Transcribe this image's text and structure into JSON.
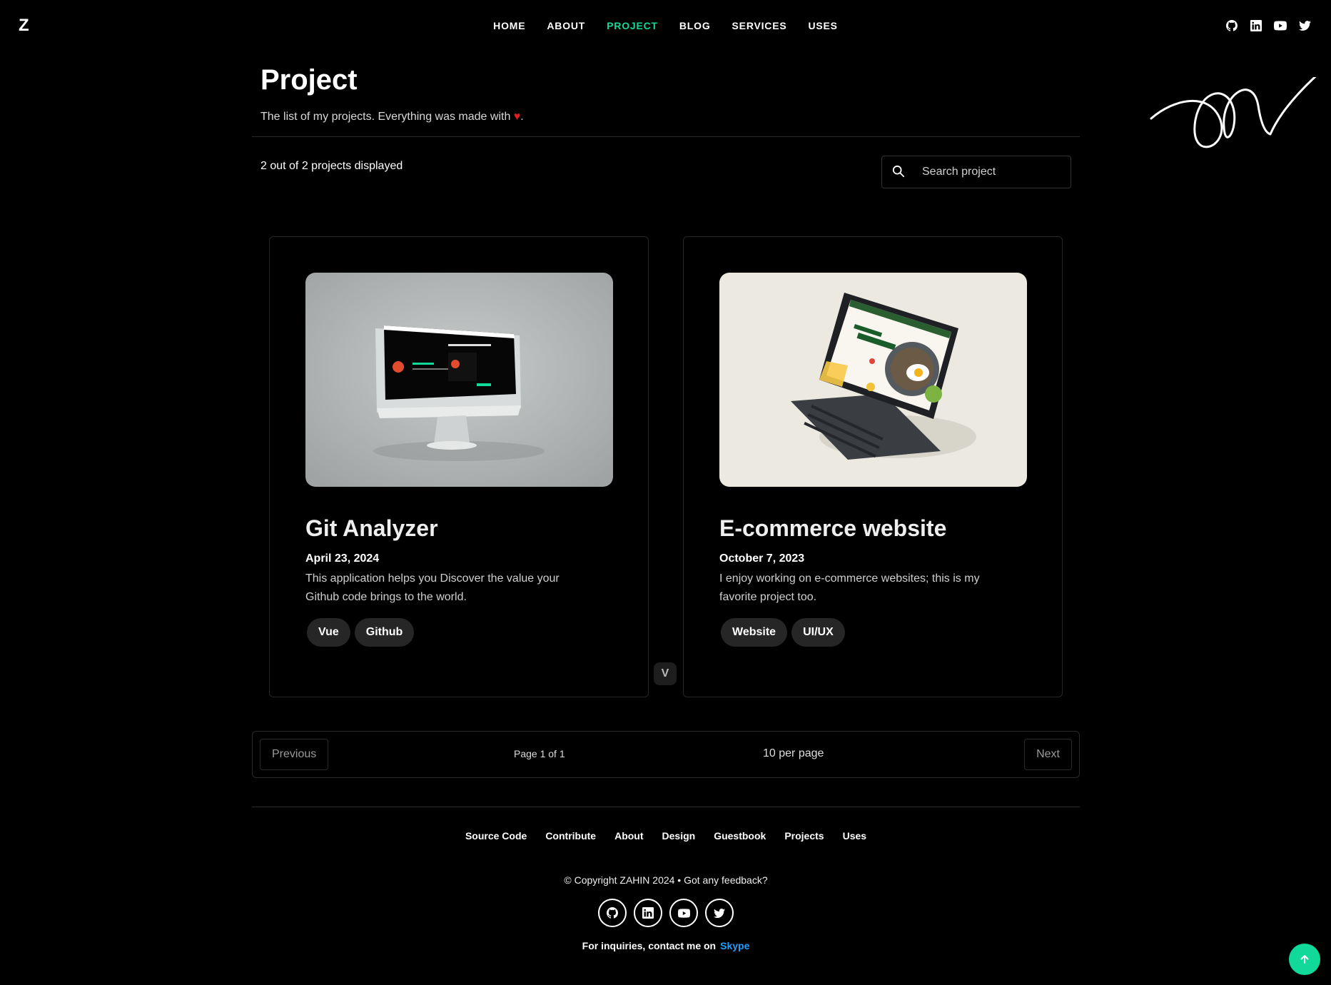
{
  "header": {
    "logo": "Z",
    "nav": [
      "HOME",
      "ABOUT",
      "PROJECT",
      "BLOG",
      "SERVICES",
      "USES"
    ],
    "active_nav": "PROJECT",
    "social_icons": [
      "github-icon",
      "linkedin-icon",
      "youtube-icon",
      "twitter-icon"
    ]
  },
  "page": {
    "title": "Project",
    "subtitle_text": "The list of my projects. Everything was made with ",
    "subtitle_end": "."
  },
  "toolbar": {
    "count": "2 out of 2 projects displayed",
    "search_placeholder": "Search project"
  },
  "projects": [
    {
      "title": "Git Analyzer",
      "date": "April 23, 2024",
      "description": "This application helps you Discover the value your Github code brings to the world.",
      "tags": [
        "Vue",
        "Github"
      ]
    },
    {
      "title": "E-commerce website",
      "date": "October 7, 2023",
      "description": "I enjoy working on e-commerce websites; this is my favorite project too.",
      "tags": [
        "Website",
        "UI/UX"
      ]
    }
  ],
  "pagination": {
    "previous": "Previous",
    "page_info": "Page 1 of 1",
    "per_page": "10 per page",
    "next": "Next"
  },
  "footer": {
    "links": [
      "Source Code",
      "Contribute",
      "About",
      "Design",
      "Guestbook",
      "Projects",
      "Uses"
    ],
    "copyright": "© Copyright ZAHIN 2024 • Got any feedback?",
    "inquiry_text": "For inquiries, contact me on",
    "inquiry_link": "Skype"
  },
  "colors": {
    "accent": "#10d99a",
    "link": "#1aa0ff",
    "heart": "#e51d1d",
    "background": "#000000"
  }
}
